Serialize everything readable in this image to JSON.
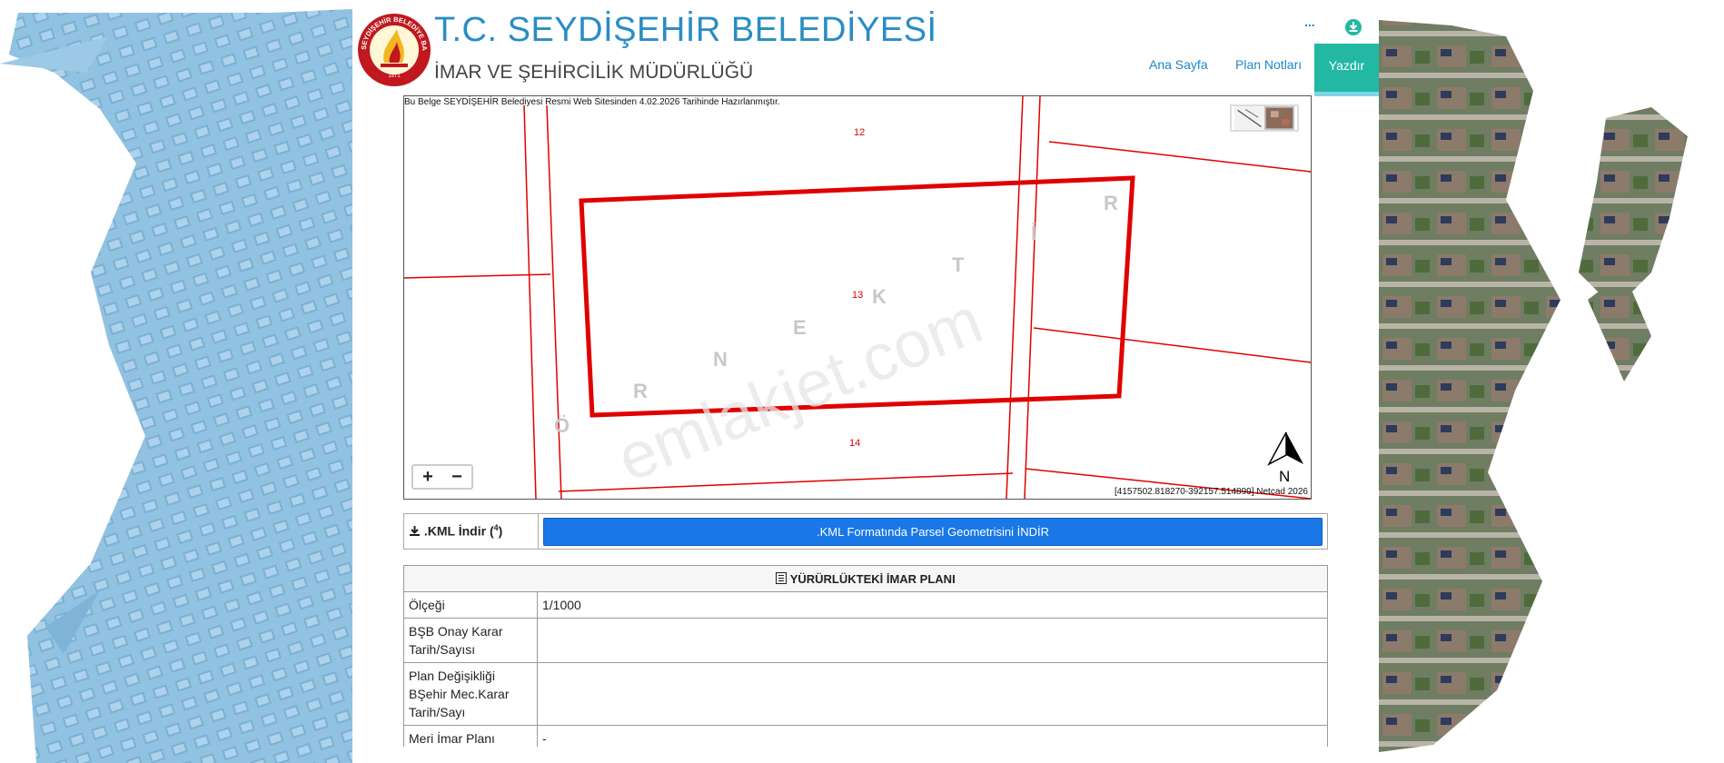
{
  "header": {
    "title": "T.C. SEYDİŞEHİR BELEDİYESİ",
    "subtitle": "İMAR VE ŞEHİRCİLİK MÜDÜRLÜĞÜ",
    "logo_ring_text": "SEYDİŞEHİR BELEDİYE BAŞKANLIĞI",
    "logo_year": "1971",
    "dots": "...",
    "nav": {
      "home": "Ana Sayfa",
      "plan_notes": "Plan Notları",
      "print": "Yazdır"
    }
  },
  "map": {
    "note": "Bu Belge SEYDİŞEHİR Belediyesi Resmi Web Sitesinden 4.02.2026 Tarihinde Hazırlanmıştır.",
    "parcel_labels": [
      "12",
      "13",
      "14"
    ],
    "watermark_letters": [
      "Ö",
      "R",
      "N",
      "E",
      "K",
      "T",
      "İ",
      "R"
    ],
    "watermark_brand": "emlakjet.com",
    "north": "N",
    "zoom_in": "+",
    "zoom_out": "−",
    "coords": "[4157502.818270-392157.514899] Netcad 2026"
  },
  "kml": {
    "label": ".KML İndir (",
    "label_sup": "4",
    "label_end": ")",
    "button": ".KML Formatında Parsel Geometrisini İNDİR"
  },
  "plan_table": {
    "header": "YÜRÜRLÜKTEKİ İMAR PLANI",
    "rows": [
      {
        "key": "Ölçeği",
        "value": "1/1000"
      },
      {
        "key": "BŞB Onay Karar Tarih/Sayısı",
        "value": ""
      },
      {
        "key": "Plan Değişikliği BŞehir Mec.Karar Tarih/Sayı",
        "value": ""
      },
      {
        "key": "Meri İmar Planı",
        "value": "-"
      }
    ]
  },
  "colors": {
    "title_blue": "#2a8dc4",
    "print_teal": "#22b8a4",
    "parcel_red": "#e00000",
    "button_blue": "#1977e6"
  }
}
